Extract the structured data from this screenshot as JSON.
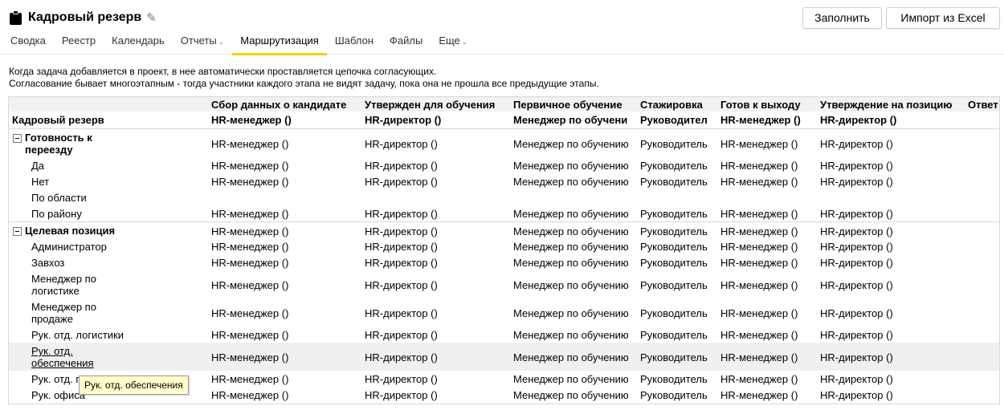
{
  "header": {
    "title": "Кадровый резерв",
    "buttons": {
      "fill": "Заполнить",
      "import": "Импорт из Excel"
    }
  },
  "tabs": [
    {
      "label": "Сводка"
    },
    {
      "label": "Реестр"
    },
    {
      "label": "Календарь"
    },
    {
      "label": "Отчеты",
      "dropdown": true
    },
    {
      "label": "Маршрутизация",
      "active": true
    },
    {
      "label": "Шаблон"
    },
    {
      "label": "Файлы"
    },
    {
      "label": "Еще",
      "dropdown": true
    }
  ],
  "info": {
    "line1": "Когда задача добавляется в проект, в нее автоматически проставляется цепочка согласующих.",
    "line2": "Согласование бывает многоэтапным - тогда участники каждого этапа не видят задачу, пока она не прошла все предыдущие этапы."
  },
  "grid": {
    "corner_label": "Кадровый резерв",
    "columns": [
      {
        "title": "Сбор данных о кандидате",
        "role": "HR-менеджер ()"
      },
      {
        "title": "Утвержден для обучения",
        "role": "HR-директор ()"
      },
      {
        "title": "Первичное обучение",
        "role": "Менеджер по обучени"
      },
      {
        "title": "Стажировка",
        "role": "Руководител"
      },
      {
        "title": "Готов к выходу",
        "role": "HR-менеджер ()"
      },
      {
        "title": "Утверждение на позицию",
        "role": "HR-директор ()"
      },
      {
        "title": "Ответ",
        "role": ""
      }
    ],
    "cell_values": [
      "HR-менеджер ()",
      "HR-директор ()",
      "Менеджер по обучению",
      "Руководитель",
      "HR-менеджер ()",
      "HR-директор ()"
    ],
    "rows": [
      {
        "label": "Готовность к\nпереезду",
        "type": "group"
      },
      {
        "label": "Да",
        "type": "item"
      },
      {
        "label": "Нет",
        "type": "item"
      },
      {
        "label": "По области",
        "type": "item",
        "empty": true
      },
      {
        "label": "По району",
        "type": "item"
      },
      {
        "label": "Целевая позиция",
        "type": "group"
      },
      {
        "label": "Администратор",
        "type": "item"
      },
      {
        "label": "Завхоз",
        "type": "item"
      },
      {
        "label": "Менеджер по\nлогистике",
        "type": "item"
      },
      {
        "label": "Менеджер по\nпродаже",
        "type": "item"
      },
      {
        "label": "Рук. отд. логистики",
        "type": "item"
      },
      {
        "label": "Рук. отд.\nобеспечения",
        "type": "item",
        "hover": true
      },
      {
        "label": "Рук. отд. персонала",
        "type": "item"
      },
      {
        "label": "Рук. офиса",
        "type": "item"
      }
    ]
  },
  "tooltip": {
    "text": "Рук. отд. обеспечения"
  }
}
